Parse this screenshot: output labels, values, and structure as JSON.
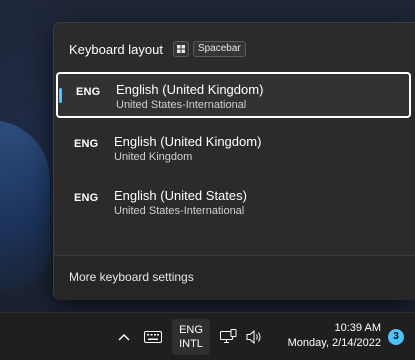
{
  "flyout": {
    "title": "Keyboard layout",
    "shortcut_key": "Spacebar",
    "layouts": [
      {
        "code": "ENG",
        "name": "English (United Kingdom)",
        "keyboard": "United States-International",
        "selected": true
      },
      {
        "code": "ENG",
        "name": "English (United Kingdom)",
        "keyboard": "United Kingdom",
        "selected": false
      },
      {
        "code": "ENG",
        "name": "English (United States)",
        "keyboard": "United States-International",
        "selected": false
      }
    ],
    "footer_link": "More keyboard settings"
  },
  "taskbar": {
    "input_indicator": {
      "line1": "ENG",
      "line2": "INTL"
    },
    "clock": {
      "time": "10:39 AM",
      "date": "Monday, 2/14/2022"
    },
    "notification_count": "3",
    "icons": [
      "chevron-up-icon",
      "touch-keyboard-icon",
      "network-icon",
      "volume-icon"
    ]
  },
  "colors": {
    "accent": "#4cc2ff",
    "flyout_bg": "#2b2b2b",
    "taskbar_bg": "#1f1f1f"
  }
}
